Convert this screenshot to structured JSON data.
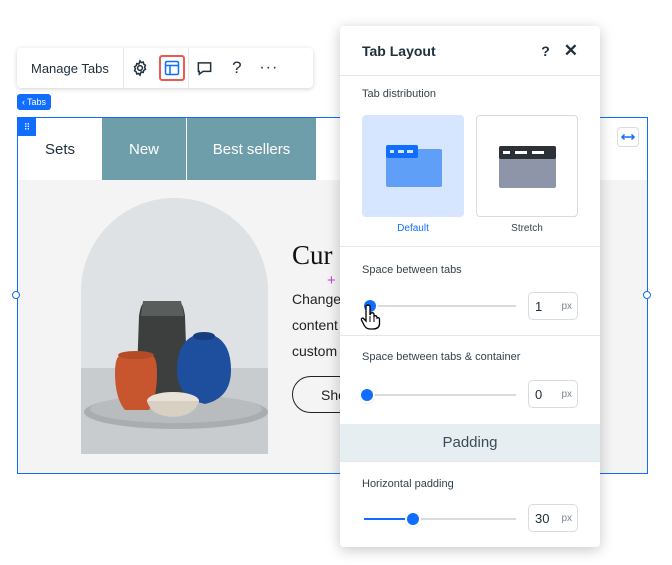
{
  "toolbar": {
    "manage_label": "Manage Tabs",
    "icons": [
      "gear-icon",
      "layout-icon",
      "comment-icon",
      "help-icon",
      "more-icon"
    ],
    "help_glyph": "?",
    "more_glyph": "···"
  },
  "tag": {
    "label": "Tabs",
    "chevron": "‹"
  },
  "tabs": [
    "Sets",
    "New",
    "Best sellers"
  ],
  "content": {
    "heading": "Cur",
    "lines": [
      "Change",
      "content",
      "custom"
    ],
    "button": "Sho"
  },
  "panel": {
    "title": "Tab Layout",
    "help": "?",
    "close": "✕",
    "distribution": {
      "label": "Tab distribution",
      "options": [
        {
          "label": "Default",
          "selected": true
        },
        {
          "label": "Stretch",
          "selected": false
        }
      ]
    },
    "space_between_tabs": {
      "label": "Space between tabs",
      "value": "1",
      "unit": "px",
      "fraction": 0.02
    },
    "space_container": {
      "label": "Space between tabs & container",
      "value": "0",
      "unit": "px",
      "fraction": 0.0
    },
    "padding_section": "Padding",
    "horizontal_padding": {
      "label": "Horizontal padding",
      "value": "30",
      "unit": "px",
      "fraction": 0.33
    }
  },
  "colors": {
    "accent": "#116dff",
    "tab_fill": "#6f9eab",
    "highlight": "#ee5951",
    "default_thumb_bg": "#d6e6fe"
  }
}
